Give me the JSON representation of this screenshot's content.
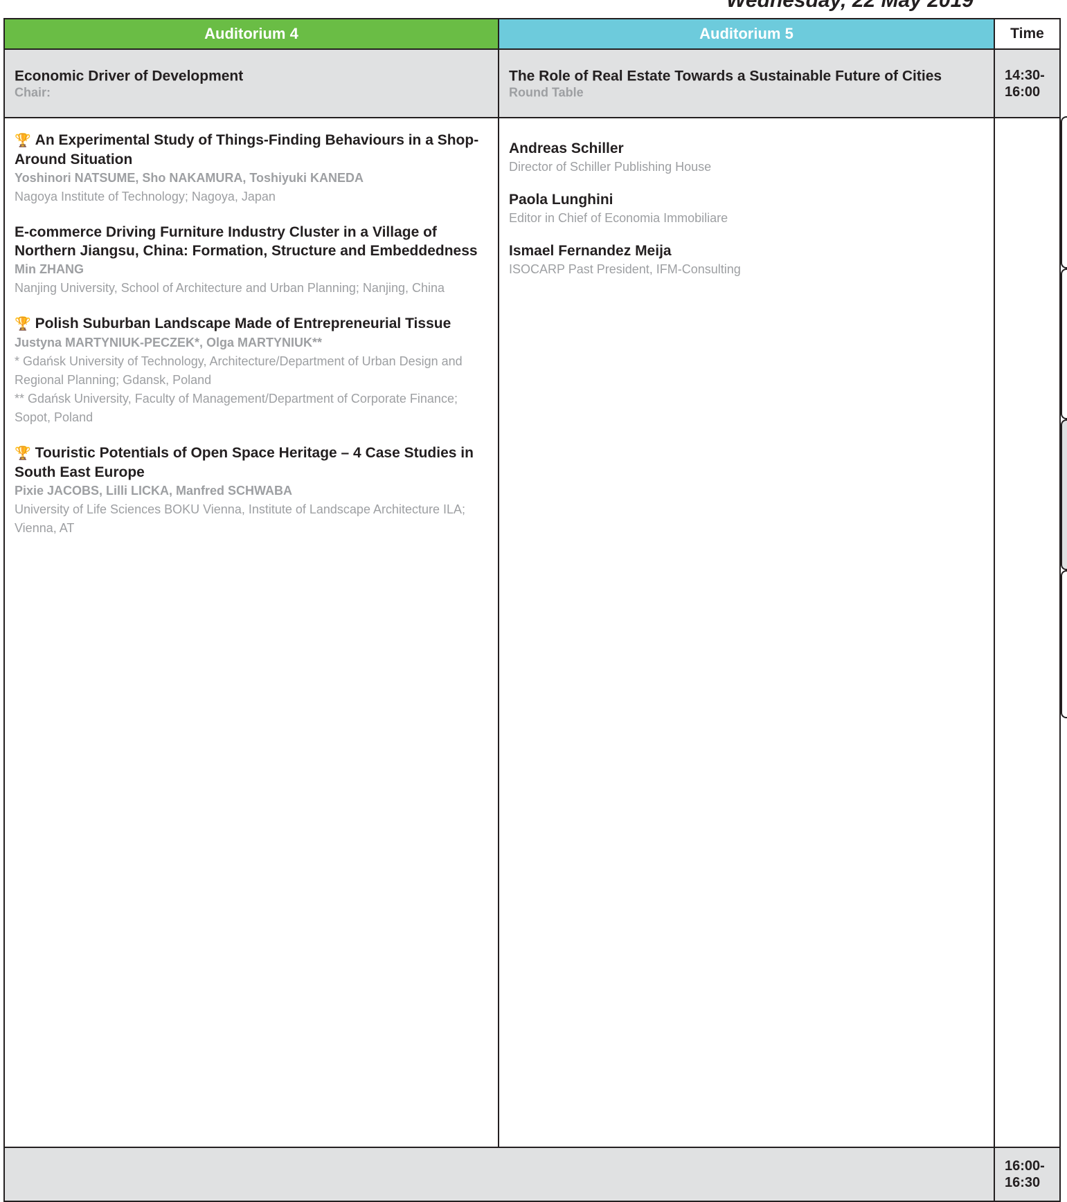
{
  "page": {
    "date": "Wednesday, 22 May 2019"
  },
  "header": {
    "auditorium_4": "Auditorium 4",
    "auditorium_5": "Auditorium 5",
    "time": "Time"
  },
  "session_row": {
    "aud4": {
      "title": "Economic Driver of Development",
      "chair": "Chair:"
    },
    "aud5": {
      "title": "The Role of Real Estate Towards a Sustainable Future of Cities",
      "subtitle": "Round Table"
    },
    "time": "14:30-\n16:00"
  },
  "aud4_papers": [
    {
      "award": true,
      "title": "An Experimental Study of Things-Finding Behaviours in a Shop-Around Situation",
      "authors": "Yoshinori NATSUME, Sho NAKAMURA, Toshiyuki KANEDA",
      "affiliation": "Nagoya Institute of Technology; Nagoya, Japan"
    },
    {
      "award": false,
      "title": "E-commerce Driving Furniture Industry Cluster in a Village of Northern Jiangsu, China: Formation, Structure and Embeddedness",
      "authors": "Min ZHANG",
      "affiliation": "Nanjing University, School of Architecture and Urban Planning; Nanjing, China"
    },
    {
      "award": true,
      "title": "Polish Suburban Landscape Made of Entrepreneurial Tissue",
      "authors": "Justyna MARTYNIUK-PECZEK*, Olga MARTYNIUK**",
      "affiliation": "* Gdańsk University of Technology, Architecture/Department of Urban Design and Regional Planning; Gdansk, Poland\n** Gdańsk University, Faculty of Management/Department of Corporate Finance; Sopot, Poland"
    },
    {
      "award": true,
      "title": "Touristic Potentials of Open Space Heritage – 4 Case Studies in South East Europe",
      "authors": "Pixie JACOBS, Lilli LICKA, Manfred SCHWABA",
      "affiliation": "University of Life Sciences BOKU Vienna, Institute of Landscape Architecture ILA; Vienna, AT"
    }
  ],
  "aud5_speakers": [
    {
      "name": "Andreas Schiller",
      "role": "Director of Schiller Publishing House"
    },
    {
      "name": "Paola Lunghini",
      "role": "Editor in Chief of Economia Immobiliare"
    },
    {
      "name": "Ismael Fernandez Meija",
      "role": "ISOCARP Past President, IFM-Consulting"
    }
  ],
  "footer_row": {
    "time": "16:00-\n16:30"
  },
  "icons": {
    "award": "trophy-icon"
  },
  "colors": {
    "aud4": "#6abd45",
    "aud5": "#6dcbdc",
    "row_grey": "#e0e1e2",
    "meta_grey": "#9d9fa2",
    "trophy": "#f2b41c"
  }
}
